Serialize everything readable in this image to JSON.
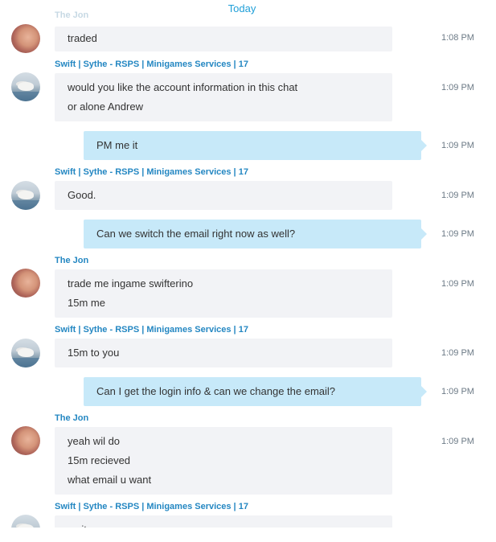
{
  "date_separator": "Today",
  "messages": [
    {
      "sender": "The Jon",
      "lines": [
        "traded"
      ],
      "time": "1:08 PM"
    },
    {
      "sender": "Swift | Sythe - RSPS | Minigames Services | 17",
      "lines": [
        "would you like the account information in this chat",
        "or alone Andrew"
      ],
      "time": "1:09 PM"
    },
    {
      "sender": "",
      "lines": [
        "PM me it"
      ],
      "time": "1:09 PM"
    },
    {
      "sender": "Swift | Sythe - RSPS | Minigames Services | 17",
      "lines": [
        "Good."
      ],
      "time": "1:09 PM"
    },
    {
      "sender": "",
      "lines": [
        "Can we switch the email right now as well?"
      ],
      "time": "1:09 PM"
    },
    {
      "sender": "The Jon",
      "lines": [
        "trade me ingame swifterino",
        "15m me"
      ],
      "time": "1:09 PM"
    },
    {
      "sender": "Swift | Sythe - RSPS | Minigames Services | 17",
      "lines": [
        "15m to you"
      ],
      "time": "1:09 PM"
    },
    {
      "sender": "",
      "lines": [
        "Can I get the login info & can we change the email?"
      ],
      "time": "1:09 PM"
    },
    {
      "sender": "The Jon",
      "lines": [
        "yeah wil do",
        "15m recieved",
        "what email u want"
      ],
      "time": "1:09 PM"
    },
    {
      "sender": "Swift | Sythe - RSPS | Minigames Services | 17",
      "lines": [
        "ye it"
      ],
      "time": ""
    }
  ],
  "colors": {
    "incoming_bubble": "#f2f3f6",
    "outgoing_bubble": "#c7e9f9",
    "sender_name": "#2487c2",
    "date_separator": "#1f9fd8",
    "timestamp": "#6c7a86"
  },
  "icons": {
    "jon_avatar": "avatar-photo",
    "swift_avatar": "avatar-photo"
  }
}
